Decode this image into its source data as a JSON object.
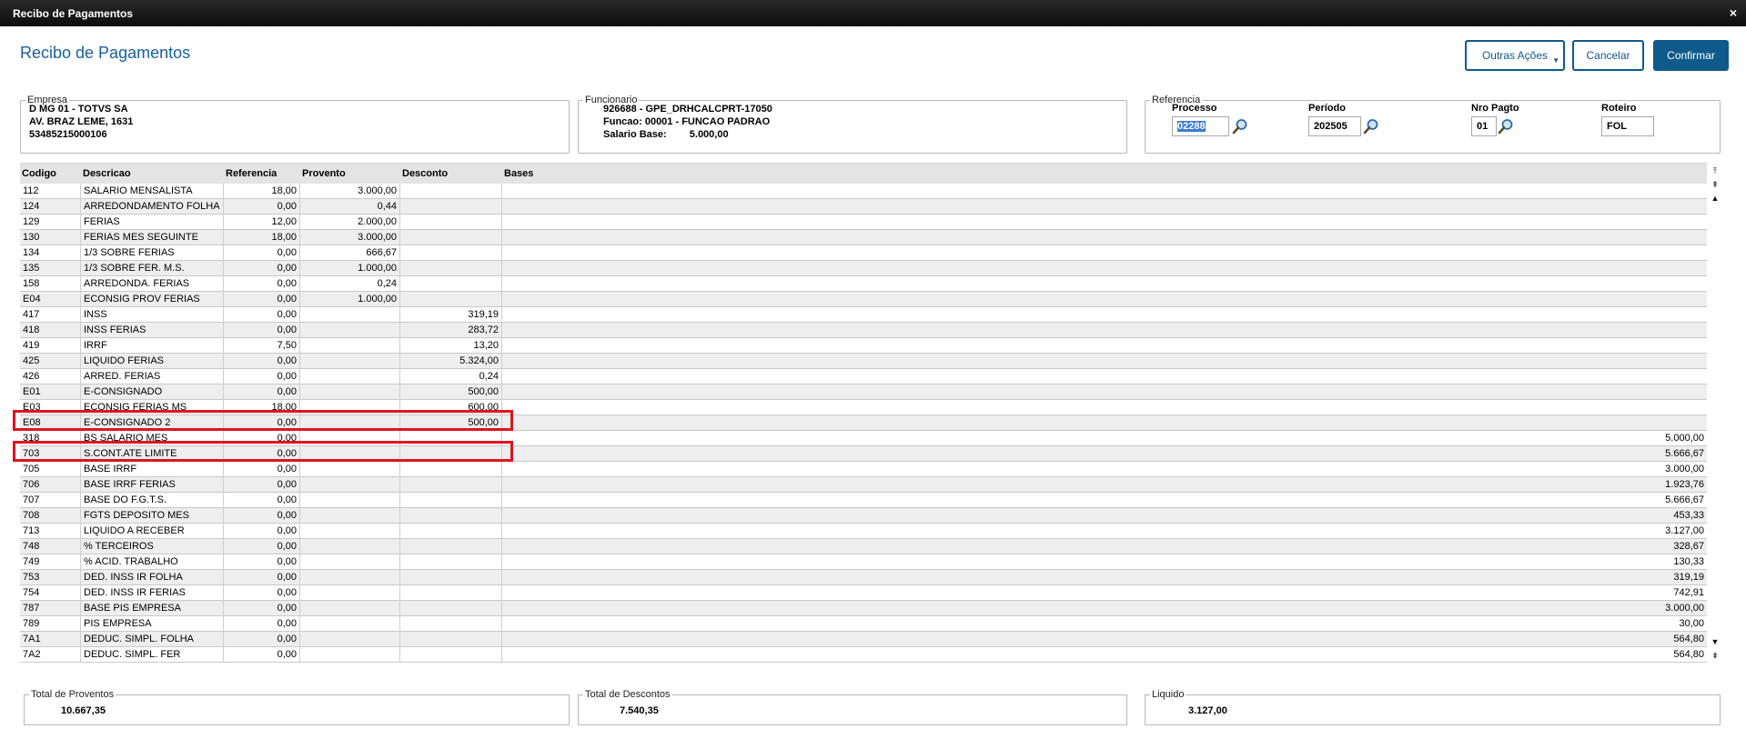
{
  "window": {
    "title": "Recibo de Pagamentos",
    "close": "×"
  },
  "page": {
    "title": "Recibo de Pagamentos"
  },
  "actions": {
    "more": "Outras Ações",
    "cancel": "Cancelar",
    "confirm": "Confirmar"
  },
  "empresa": {
    "legend": "Empresa",
    "line1": "D MG 01  - TOTVS SA",
    "line2": "AV. BRAZ LEME, 1631",
    "line3": "53485215000106"
  },
  "funcionario": {
    "legend": "Funcionario",
    "line1": "926688 - GPE_DRHCALCPRT-17050",
    "line2": "Funcao: 00001 - FUNCAO PADRAO",
    "salario_label": "Salario Base:",
    "salario_value": "5.000,00"
  },
  "referencia": {
    "legend": "Referencia",
    "processo_label": "Processo",
    "processo_value": "02288",
    "periodo_label": "Período",
    "periodo_value": "202505",
    "nro_label": "Nro Pagto",
    "nro_value": "01",
    "roteiro_label": "Roteiro",
    "roteiro_value": "FOL"
  },
  "grid": {
    "columns": [
      "Codigo",
      "Descricao",
      "Referencia",
      "Provento",
      "Desconto",
      "Bases"
    ],
    "rows": [
      [
        "112",
        "SALARIO MENSALISTA",
        "18,00",
        "3.000,00",
        "",
        ""
      ],
      [
        "124",
        "ARREDONDAMENTO FOLHA",
        "0,00",
        "0,44",
        "",
        ""
      ],
      [
        "129",
        "FERIAS",
        "12,00",
        "2.000,00",
        "",
        ""
      ],
      [
        "130",
        "FERIAS MES SEGUINTE",
        "18,00",
        "3.000,00",
        "",
        ""
      ],
      [
        "134",
        "1/3 SOBRE FERIAS",
        "0,00",
        "666,67",
        "",
        ""
      ],
      [
        "135",
        "1/3 SOBRE FER. M.S.",
        "0,00",
        "1.000,00",
        "",
        ""
      ],
      [
        "158",
        "ARREDONDA. FERIAS",
        "0,00",
        "0,24",
        "",
        ""
      ],
      [
        "E04",
        "ECONSIG PROV FERIAS",
        "0,00",
        "1.000,00",
        "",
        ""
      ],
      [
        "417",
        "INSS",
        "0,00",
        "",
        "319,19",
        ""
      ],
      [
        "418",
        "INSS FERIAS",
        "0,00",
        "",
        "283,72",
        ""
      ],
      [
        "419",
        "IRRF",
        "7,50",
        "",
        "13,20",
        ""
      ],
      [
        "425",
        "LIQUIDO FERIAS",
        "0,00",
        "",
        "5.324,00",
        ""
      ],
      [
        "426",
        "ARRED. FERIAS",
        "0,00",
        "",
        "0,24",
        ""
      ],
      [
        "E01",
        "E-CONSIGNADO",
        "0,00",
        "",
        "500,00",
        ""
      ],
      [
        "E03",
        "ECONSIG FERIAS MS",
        "18,00",
        "",
        "600,00",
        ""
      ],
      [
        "E08",
        "E-CONSIGNADO 2",
        "0,00",
        "",
        "500,00",
        ""
      ],
      [
        "318",
        "BS SALARIO MES",
        "0,00",
        "",
        "",
        "5.000,00"
      ],
      [
        "703",
        "S.CONT.ATE LIMITE",
        "0,00",
        "",
        "",
        "5.666,67"
      ],
      [
        "705",
        "BASE IRRF",
        "0,00",
        "",
        "",
        "3.000,00"
      ],
      [
        "706",
        "BASE IRRF FERIAS",
        "0,00",
        "",
        "",
        "1.923,76"
      ],
      [
        "707",
        "BASE DO F.G.T.S.",
        "0,00",
        "",
        "",
        "5.666,67"
      ],
      [
        "708",
        "FGTS DEPOSITO MES",
        "0,00",
        "",
        "",
        "453,33"
      ],
      [
        "713",
        "LIQUIDO A RECEBER",
        "0,00",
        "",
        "",
        "3.127,00"
      ],
      [
        "748",
        "% TERCEIROS",
        "0,00",
        "",
        "",
        "328,67"
      ],
      [
        "749",
        "% ACID. TRABALHO",
        "0,00",
        "",
        "",
        "130,33"
      ],
      [
        "753",
        "DED. INSS IR FOLHA",
        "0,00",
        "",
        "",
        "319,19"
      ],
      [
        "754",
        "DED. INSS IR FERIAS",
        "0,00",
        "",
        "",
        "742,91"
      ],
      [
        "787",
        "BASE PIS EMPRESA",
        "0,00",
        "",
        "",
        "3.000,00"
      ],
      [
        "789",
        "PIS EMPRESA",
        "0,00",
        "",
        "",
        "30,00"
      ],
      [
        "7A1",
        "DEDUC. SIMPL. FOLHA",
        "0,00",
        "",
        "",
        "564,80"
      ],
      [
        "7A2",
        "DEDUC. SIMPL. FER",
        "0,00",
        "",
        "",
        "564,80"
      ]
    ],
    "highlighted_codes": [
      "E01",
      "E08"
    ]
  },
  "totals": {
    "proventos_label": "Total de Proventos",
    "proventos_value": "10.667,35",
    "descontos_label": "Total de Descontos",
    "descontos_value": "7.540,35",
    "liquido_label": "Liquido",
    "liquido_value": "3.127,00"
  },
  "colors": {
    "accent": "#0e5a8a",
    "title": "#1a5fa0",
    "highlight": "#e0141e"
  }
}
